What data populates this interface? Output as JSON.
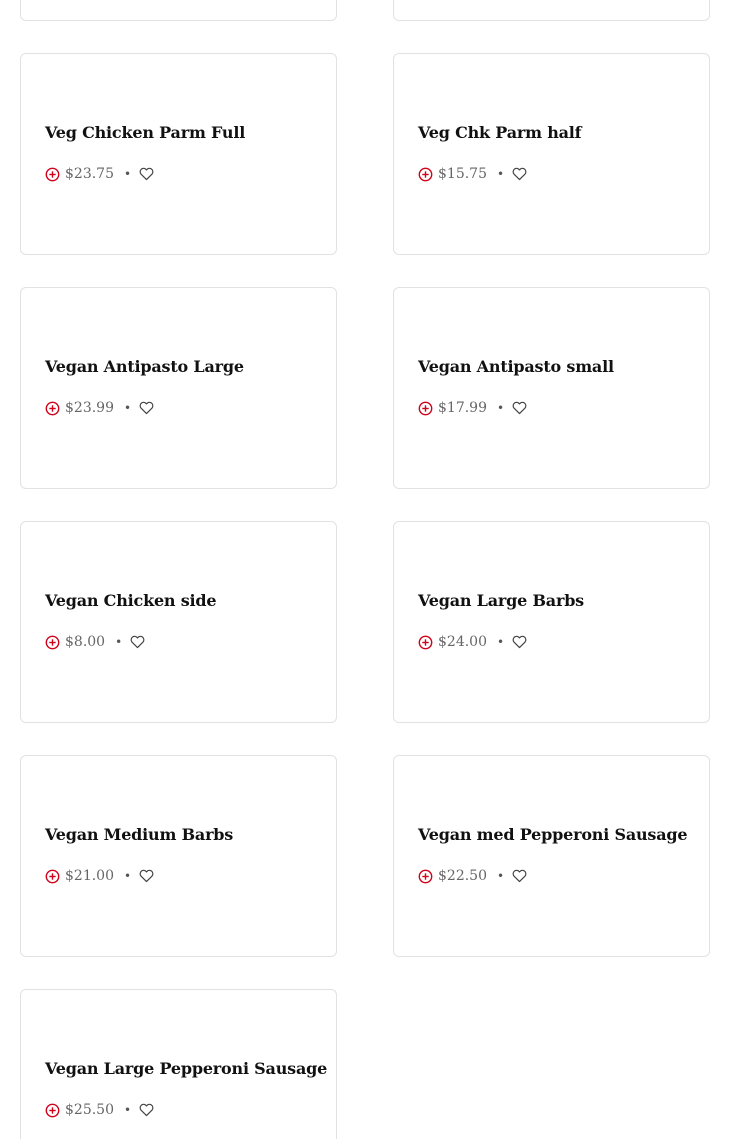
{
  "accent_color": "#d0021b",
  "icons": {
    "add": "plus-circle-icon",
    "favorite": "heart-outline-icon"
  },
  "items": [
    {
      "name": "Veg Chicken Parm Full",
      "price": "$23.75"
    },
    {
      "name": "Veg Chk Parm half",
      "price": "$15.75"
    },
    {
      "name": "Vegan Antipasto Large",
      "price": "$23.99"
    },
    {
      "name": "Vegan Antipasto small",
      "price": "$17.99"
    },
    {
      "name": "Vegan Chicken side",
      "price": "$8.00"
    },
    {
      "name": "Vegan Large Barbs",
      "price": "$24.00"
    },
    {
      "name": "Vegan Medium Barbs",
      "price": "$21.00"
    },
    {
      "name": "Vegan med Pepperoni Sausage",
      "price": "$22.50"
    },
    {
      "name": "Vegan Large Pepperoni Sausage",
      "price": "$25.50"
    }
  ],
  "separator": "•"
}
